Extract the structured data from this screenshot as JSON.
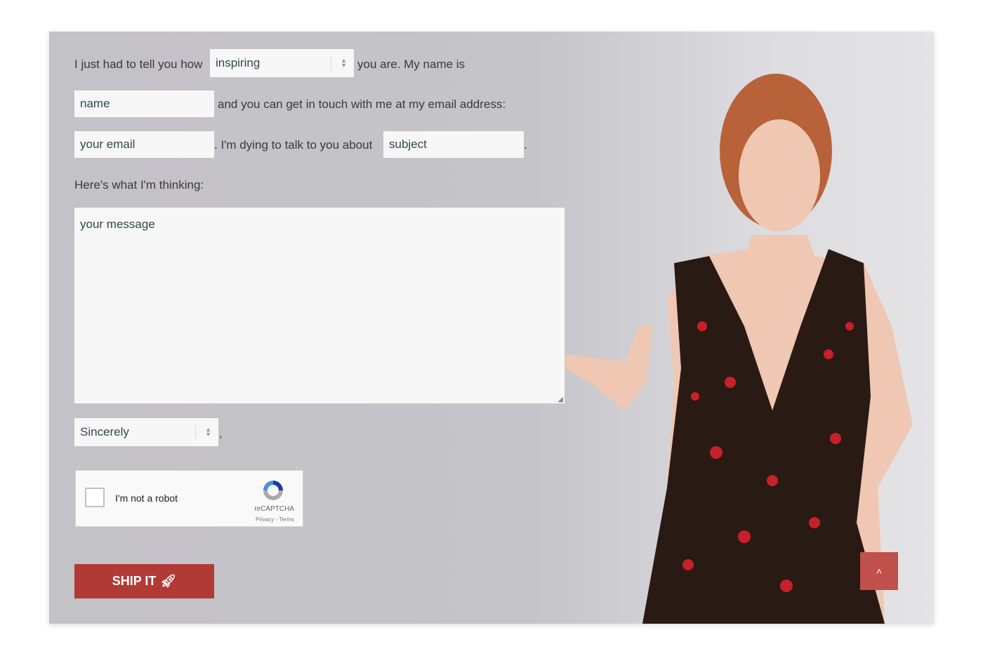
{
  "form": {
    "intro_text": "I just had to tell you how",
    "adjective_select": {
      "value": "inspiring"
    },
    "after_adjective": "you are. My name is",
    "name_placeholder": "name",
    "after_name": "and you can get in touch with me at my email address:",
    "email_placeholder": "your email",
    "after_email": ". I'm dying to talk to you about",
    "subject_placeholder": "subject",
    "after_subject": ".",
    "thinking_label": "Here's what I'm thinking:",
    "message_placeholder": "your message",
    "signoff_select": {
      "value": "Sincerely"
    },
    "after_signoff": ","
  },
  "captcha": {
    "label": "I'm not a robot",
    "brand": "reCAPTCHA",
    "links": "Privacy - Terms"
  },
  "submit": {
    "label": "SHIP IT",
    "icon": "rocket-icon"
  },
  "scroll_top": {
    "icon": "chevron-up-icon"
  },
  "colors": {
    "accent": "#b23a36",
    "background": "#c4c3c8"
  }
}
